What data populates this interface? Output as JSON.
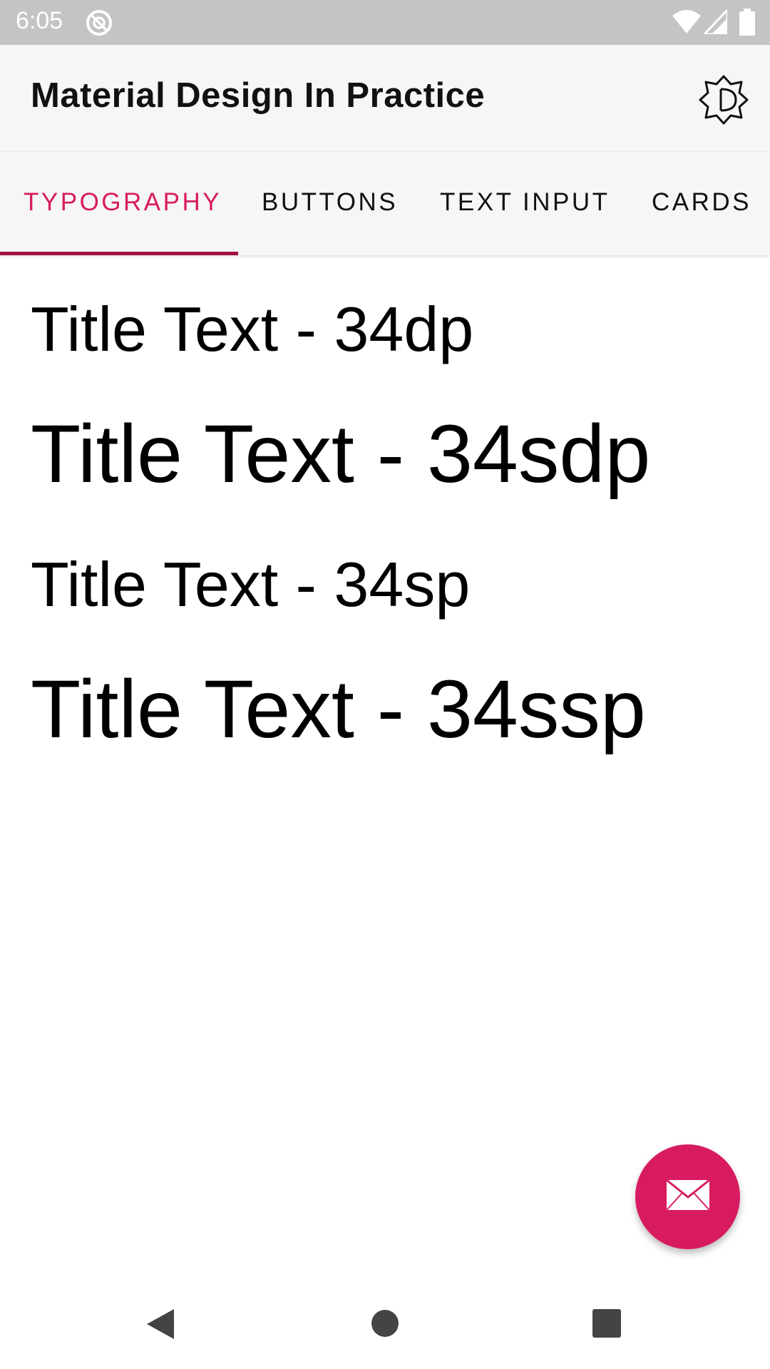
{
  "status_bar": {
    "time": "6:05",
    "icons": [
      "sync-icon",
      "wifi-icon",
      "signal-icon",
      "battery-icon"
    ]
  },
  "app_bar": {
    "title": "Material Design In Practice",
    "action_icon": "theme-toggle-icon"
  },
  "tabs": [
    {
      "label": "TYPOGRAPHY",
      "active": true
    },
    {
      "label": "BUTTONS",
      "active": false
    },
    {
      "label": "TEXT INPUT",
      "active": false
    },
    {
      "label": "CARDS",
      "active": false
    }
  ],
  "content": {
    "lines": [
      "Title Text - 34dp",
      "Title Text - 34sdp",
      "Title Text - 34sp",
      "Title Text - 34ssp"
    ]
  },
  "fab": {
    "icon": "mail-icon"
  },
  "nav_bar": {
    "icons": [
      "back-icon",
      "home-icon",
      "recents-icon"
    ]
  },
  "colors": {
    "accent": "#d81b60",
    "indicator": "#a3123f",
    "status_bar": "#c4c4c4",
    "app_bar": "#f6f6f6"
  }
}
